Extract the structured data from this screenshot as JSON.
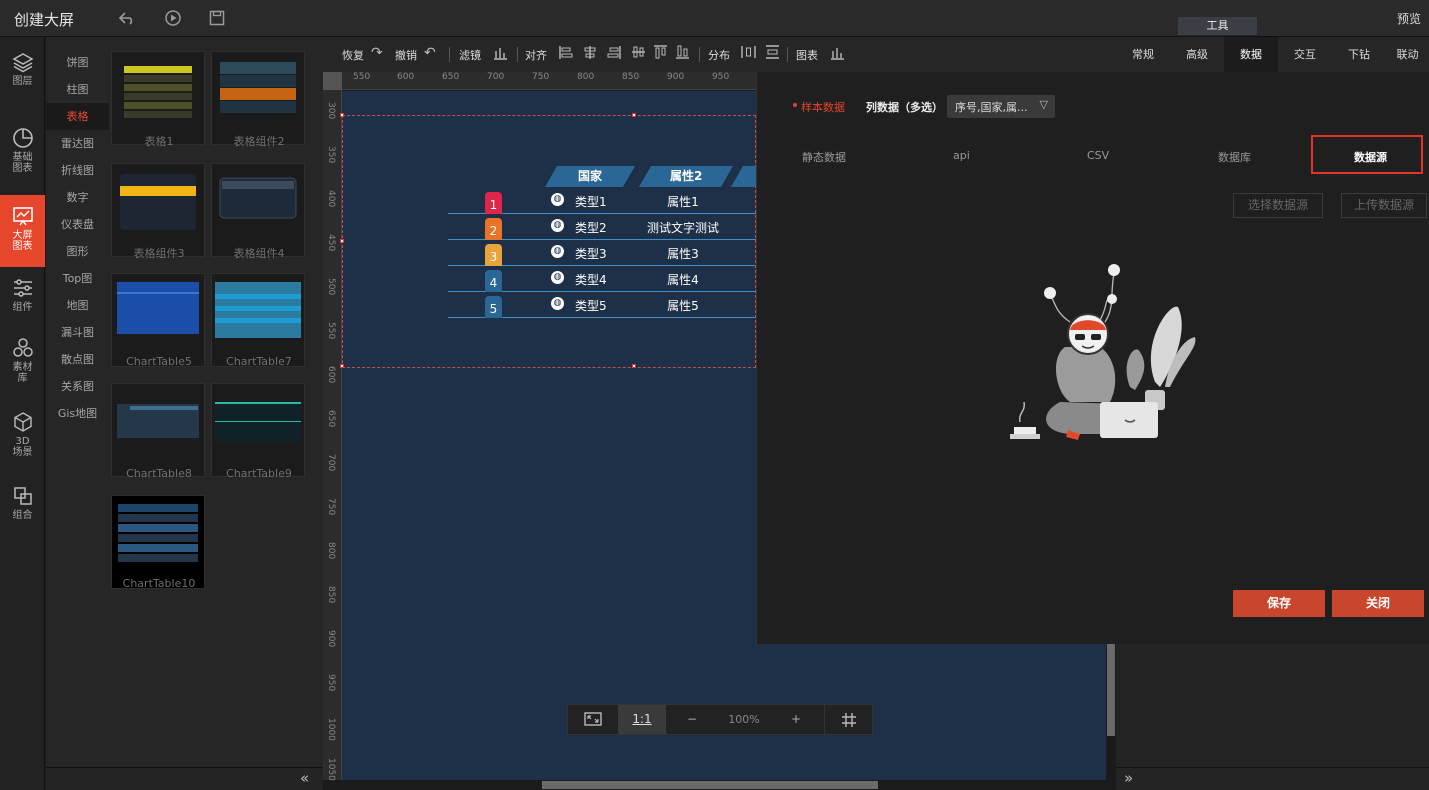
{
  "header": {
    "title": "创建大屏",
    "preview_label": "预览",
    "tools_tab_label": "工具"
  },
  "icon_rail": [
    {
      "label1": "图层",
      "label2": "",
      "icon": "layers-icon"
    },
    {
      "label1": "基础",
      "label2": "图表",
      "icon": "pie-chart-icon"
    },
    {
      "label1": "大屏",
      "label2": "图表",
      "icon": "screen-chart-icon",
      "active": true
    },
    {
      "label1": "组件",
      "label2": "",
      "icon": "sliders-icon"
    },
    {
      "label1": "素材",
      "label2": "库",
      "icon": "assets-icon"
    },
    {
      "label1": "3D",
      "label2": "场景",
      "icon": "cube-icon"
    },
    {
      "label1": "组合",
      "label2": "",
      "icon": "group-icon"
    }
  ],
  "categories": [
    "饼图",
    "柱图",
    "表格",
    "雷达图",
    "折线图",
    "数字",
    "仪表盘",
    "图形",
    "Top图",
    "地图",
    "漏斗图",
    "散点图",
    "关系图",
    "Gis地图"
  ],
  "active_category": "表格",
  "components": [
    "表格1",
    "表格组件2",
    "表格组件3",
    "表格组件4",
    "ChartTable5",
    "ChartTable7",
    "ChartTable8",
    "ChartTable9",
    "ChartTable10"
  ],
  "edit_toolbar": {
    "restore": "恢复",
    "undo": "撤销",
    "filter": "滤镜",
    "align": "对齐",
    "distribute": "分布",
    "chart": "图表"
  },
  "ruler": {
    "h_ticks": [
      "550",
      "600",
      "650",
      "700",
      "750",
      "800",
      "850",
      "900",
      "950"
    ],
    "v_ticks": [
      "300",
      "350",
      "400",
      "450",
      "500",
      "550",
      "600",
      "650",
      "700",
      "750",
      "800",
      "850",
      "900",
      "950",
      "1000",
      "1050"
    ]
  },
  "table_widget": {
    "headers": [
      "国家",
      "属性2"
    ],
    "rows": [
      {
        "rank": "1",
        "country": "类型1",
        "attr": "属性1",
        "color": "#e0254b"
      },
      {
        "rank": "2",
        "country": "类型2",
        "attr": "测试文字测试",
        "color": "#e8742a"
      },
      {
        "rank": "3",
        "country": "类型3",
        "attr": "属性3",
        "color": "#e8a43a"
      },
      {
        "rank": "4",
        "country": "类型4",
        "attr": "属性4",
        "color": "#2a6796"
      },
      {
        "rank": "5",
        "country": "类型5",
        "attr": "属性5",
        "color": "#2a6796"
      }
    ]
  },
  "zoom": {
    "ratio_label": "1:1",
    "minus": "−",
    "value": "100%",
    "plus": "+"
  },
  "right_tabs": [
    "常规",
    "高级",
    "数据",
    "交互",
    "下钻",
    "联动"
  ],
  "active_right_tab": "数据",
  "data_dialog": {
    "sample_label": "样本数据",
    "columns_label": "列数据（多选）",
    "columns_value": "序号,国家,属...",
    "subtabs": [
      "静态数据",
      "api",
      "CSV",
      "数据库",
      "数据源"
    ],
    "active_subtab": "数据源",
    "select_source": "选择数据源",
    "upload_source": "上传数据源",
    "save": "保存",
    "close": "关闭"
  }
}
